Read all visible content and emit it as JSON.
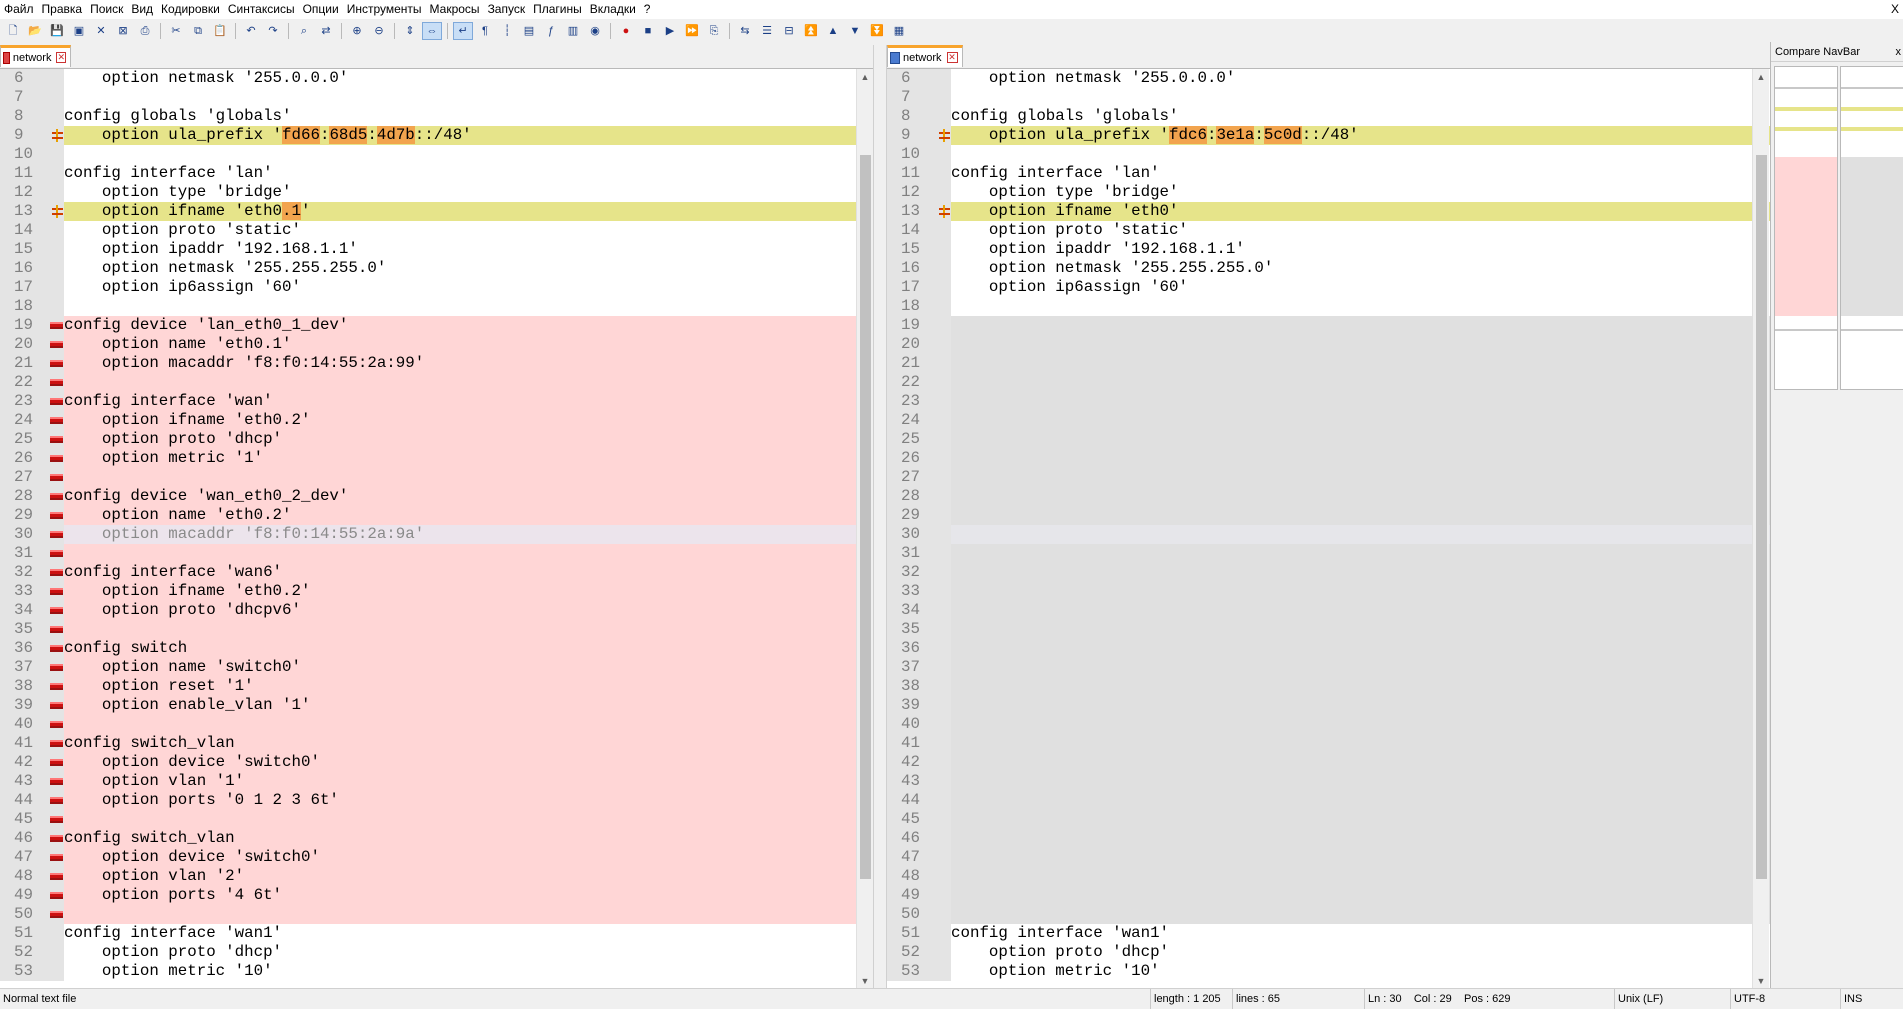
{
  "menu": {
    "items": [
      "Файл",
      "Правка",
      "Поиск",
      "Вид",
      "Кодировки",
      "Синтаксисы",
      "Опции",
      "Инструменты",
      "Макросы",
      "Запуск",
      "Плагины",
      "Вкладки",
      "?"
    ],
    "close": "X"
  },
  "toolbar": {
    "icons": [
      "new-file-icon",
      "open-file-icon",
      "save-icon",
      "save-all-icon",
      "close-icon",
      "close-all-icon",
      "print-icon",
      "cut-icon",
      "copy-icon",
      "paste-icon",
      "undo-icon",
      "redo-icon",
      "find-icon",
      "replace-icon",
      "zoom-in-icon",
      "zoom-out-icon",
      "sync-vertical-icon",
      "sync-horizontal-icon",
      "word-wrap-icon",
      "show-all-chars-icon",
      "indent-guide-icon",
      "doc-map-icon",
      "function-list-icon",
      "folder-workspace-icon",
      "monitor-icon",
      "record-macro-icon",
      "stop-record-icon",
      "play-macro-icon",
      "run-multiple-macro-icon",
      "save-macro-icon",
      "compare-icon",
      "compare-lines-icon",
      "clear-compare-icon",
      "first-diff-icon",
      "prev-diff-icon",
      "next-diff-icon",
      "last-diff-icon",
      "navbar-icon"
    ]
  },
  "left_tab": {
    "label": "network"
  },
  "right_tab": {
    "label": "network"
  },
  "left_lines": [
    {
      "n": "6",
      "text": "    option netmask '255.0.0.0'",
      "kind": "normal"
    },
    {
      "n": "7",
      "text": "",
      "kind": "normal"
    },
    {
      "n": "8",
      "text": "config globals 'globals'",
      "kind": "normal"
    },
    {
      "n": "9",
      "text": "    option ula_prefix 'fd66:68d5:4d7b::/48'",
      "kind": "changed"
    },
    {
      "n": "10",
      "text": "",
      "kind": "normal"
    },
    {
      "n": "11",
      "text": "config interface 'lan'",
      "kind": "normal"
    },
    {
      "n": "12",
      "text": "    option type 'bridge'",
      "kind": "normal"
    },
    {
      "n": "13",
      "text": "    option ifname 'eth0.1'",
      "kind": "changed"
    },
    {
      "n": "14",
      "text": "    option proto 'static'",
      "kind": "normal"
    },
    {
      "n": "15",
      "text": "    option ipaddr '192.168.1.1'",
      "kind": "normal"
    },
    {
      "n": "16",
      "text": "    option netmask '255.255.255.0'",
      "kind": "normal"
    },
    {
      "n": "17",
      "text": "    option ip6assign '60'",
      "kind": "normal"
    },
    {
      "n": "18",
      "text": "",
      "kind": "normal"
    },
    {
      "n": "19",
      "text": "config device 'lan_eth0_1_dev'",
      "kind": "removed"
    },
    {
      "n": "20",
      "text": "    option name 'eth0.1'",
      "kind": "removed"
    },
    {
      "n": "21",
      "text": "    option macaddr 'f8:f0:14:55:2a:99'",
      "kind": "removed"
    },
    {
      "n": "22",
      "text": "",
      "kind": "removed"
    },
    {
      "n": "23",
      "text": "config interface 'wan'",
      "kind": "removed"
    },
    {
      "n": "24",
      "text": "    option ifname 'eth0.2'",
      "kind": "removed"
    },
    {
      "n": "25",
      "text": "    option proto 'dhcp'",
      "kind": "removed"
    },
    {
      "n": "26",
      "text": "    option metric '1'",
      "kind": "removed"
    },
    {
      "n": "27",
      "text": "",
      "kind": "removed"
    },
    {
      "n": "28",
      "text": "config device 'wan_eth0_2_dev'",
      "kind": "removed"
    },
    {
      "n": "29",
      "text": "    option name 'eth0.2'",
      "kind": "removed"
    },
    {
      "n": "30",
      "text": "    option macaddr 'f8:f0:14:55:2a:9a'",
      "kind": "caret"
    },
    {
      "n": "31",
      "text": "",
      "kind": "removed"
    },
    {
      "n": "32",
      "text": "config interface 'wan6'",
      "kind": "removed"
    },
    {
      "n": "33",
      "text": "    option ifname 'eth0.2'",
      "kind": "removed"
    },
    {
      "n": "34",
      "text": "    option proto 'dhcpv6'",
      "kind": "removed"
    },
    {
      "n": "35",
      "text": "",
      "kind": "removed"
    },
    {
      "n": "36",
      "text": "config switch",
      "kind": "removed"
    },
    {
      "n": "37",
      "text": "    option name 'switch0'",
      "kind": "removed"
    },
    {
      "n": "38",
      "text": "    option reset '1'",
      "kind": "removed"
    },
    {
      "n": "39",
      "text": "    option enable_vlan '1'",
      "kind": "removed"
    },
    {
      "n": "40",
      "text": "",
      "kind": "removed"
    },
    {
      "n": "41",
      "text": "config switch_vlan",
      "kind": "removed"
    },
    {
      "n": "42",
      "text": "    option device 'switch0'",
      "kind": "removed"
    },
    {
      "n": "43",
      "text": "    option vlan '1'",
      "kind": "removed"
    },
    {
      "n": "44",
      "text": "    option ports '0 1 2 3 6t'",
      "kind": "removed"
    },
    {
      "n": "45",
      "text": "",
      "kind": "removed"
    },
    {
      "n": "46",
      "text": "config switch_vlan",
      "kind": "removed"
    },
    {
      "n": "47",
      "text": "    option device 'switch0'",
      "kind": "removed"
    },
    {
      "n": "48",
      "text": "    option vlan '2'",
      "kind": "removed"
    },
    {
      "n": "49",
      "text": "    option ports '4 6t'",
      "kind": "removed"
    },
    {
      "n": "50",
      "text": "",
      "kind": "removed"
    },
    {
      "n": "51",
      "text": "config interface 'wan1'",
      "kind": "normal"
    },
    {
      "n": "52",
      "text": "    option proto 'dhcp'",
      "kind": "normal"
    },
    {
      "n": "53",
      "text": "    option metric '10'",
      "kind": "normal"
    }
  ],
  "right_lines": [
    {
      "n": "6",
      "text": "    option netmask '255.0.0.0'",
      "kind": "normal"
    },
    {
      "n": "7",
      "text": "",
      "kind": "normal"
    },
    {
      "n": "8",
      "text": "config globals 'globals'",
      "kind": "normal"
    },
    {
      "n": "9",
      "text": "    option ula_prefix 'fdc6:3e1a:5c0d::/48'",
      "kind": "changed"
    },
    {
      "n": "10",
      "text": "",
      "kind": "normal"
    },
    {
      "n": "11",
      "text": "config interface 'lan'",
      "kind": "normal"
    },
    {
      "n": "12",
      "text": "    option type 'bridge'",
      "kind": "normal"
    },
    {
      "n": "13",
      "text": "    option ifname 'eth0'",
      "kind": "changed"
    },
    {
      "n": "14",
      "text": "    option proto 'static'",
      "kind": "normal"
    },
    {
      "n": "15",
      "text": "    option ipaddr '192.168.1.1'",
      "kind": "normal"
    },
    {
      "n": "16",
      "text": "    option netmask '255.255.255.0'",
      "kind": "normal"
    },
    {
      "n": "17",
      "text": "    option ip6assign '60'",
      "kind": "normal"
    },
    {
      "n": "18",
      "text": "",
      "kind": "normal"
    },
    {
      "n": "19",
      "text": "",
      "kind": "blank"
    },
    {
      "n": "20",
      "text": "",
      "kind": "blank"
    },
    {
      "n": "21",
      "text": "",
      "kind": "blank"
    },
    {
      "n": "22",
      "text": "",
      "kind": "blank"
    },
    {
      "n": "23",
      "text": "",
      "kind": "blank"
    },
    {
      "n": "24",
      "text": "",
      "kind": "blank"
    },
    {
      "n": "25",
      "text": "",
      "kind": "blank"
    },
    {
      "n": "26",
      "text": "",
      "kind": "blank"
    },
    {
      "n": "27",
      "text": "",
      "kind": "blank"
    },
    {
      "n": "28",
      "text": "",
      "kind": "blank"
    },
    {
      "n": "29",
      "text": "",
      "kind": "blank"
    },
    {
      "n": "30",
      "text": "",
      "kind": "caret-blank"
    },
    {
      "n": "31",
      "text": "",
      "kind": "blank"
    },
    {
      "n": "32",
      "text": "",
      "kind": "blank"
    },
    {
      "n": "33",
      "text": "",
      "kind": "blank"
    },
    {
      "n": "34",
      "text": "",
      "kind": "blank"
    },
    {
      "n": "35",
      "text": "",
      "kind": "blank"
    },
    {
      "n": "36",
      "text": "",
      "kind": "blank"
    },
    {
      "n": "37",
      "text": "",
      "kind": "blank"
    },
    {
      "n": "38",
      "text": "",
      "kind": "blank"
    },
    {
      "n": "39",
      "text": "",
      "kind": "blank"
    },
    {
      "n": "40",
      "text": "",
      "kind": "blank"
    },
    {
      "n": "41",
      "text": "",
      "kind": "blank"
    },
    {
      "n": "42",
      "text": "",
      "kind": "blank"
    },
    {
      "n": "43",
      "text": "",
      "kind": "blank"
    },
    {
      "n": "44",
      "text": "",
      "kind": "blank"
    },
    {
      "n": "45",
      "text": "",
      "kind": "blank"
    },
    {
      "n": "46",
      "text": "",
      "kind": "blank"
    },
    {
      "n": "47",
      "text": "",
      "kind": "blank"
    },
    {
      "n": "48",
      "text": "",
      "kind": "blank"
    },
    {
      "n": "49",
      "text": "",
      "kind": "blank"
    },
    {
      "n": "50",
      "text": "",
      "kind": "blank"
    },
    {
      "n": "51",
      "text": "config interface 'wan1'",
      "kind": "normal"
    },
    {
      "n": "52",
      "text": "    option proto 'dhcp'",
      "kind": "normal"
    },
    {
      "n": "53",
      "text": "    option metric '10'",
      "kind": "normal"
    }
  ],
  "highlights": {
    "left": {
      "9": [
        "fd66",
        "68d5",
        "4d7b"
      ],
      "13": [
        ".1"
      ]
    },
    "right": {
      "9": [
        "fdc6",
        "3e1a",
        "5c0d"
      ]
    }
  },
  "navbar": {
    "title": "Compare NavBar",
    "close": "x"
  },
  "status": {
    "file_type": "Normal text file",
    "length": "length : 1 205",
    "lines": "lines : 65",
    "position": "Ln : 30    Col : 29    Pos : 629",
    "eol": "Unix (LF)",
    "encoding": "UTF-8",
    "mode": "INS"
  },
  "colors": {
    "changed": "#e6e48a",
    "removed": "#ffd6d6",
    "blank": "#e0e0e0",
    "highlight": "#f2a44e",
    "tab_accent": "#f8a42d"
  }
}
